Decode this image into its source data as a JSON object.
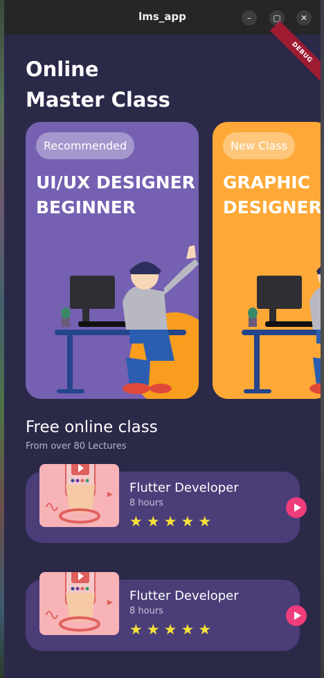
{
  "window": {
    "title": "lms_app",
    "debug_label": "DEBUG"
  },
  "header": {
    "line1": "Online",
    "line2": "Master Class"
  },
  "cards": [
    {
      "badge": "Recommended",
      "title_line1": "UI/UX DESIGNER",
      "title_line2": "BEGINNER",
      "color": "#7560b2"
    },
    {
      "badge": "New Class",
      "title_line1": "GRAPHIC",
      "title_line2": "DESIGNER M",
      "color": "#fea937"
    }
  ],
  "section": {
    "title": "Free online class",
    "subtitle": "From over 80 Lectures"
  },
  "courses": [
    {
      "title": "Flutter Developer",
      "hours": "8 hours",
      "rating": 5
    },
    {
      "title": "Flutter Developer",
      "hours": "8 hours",
      "rating": 5
    }
  ],
  "colors": {
    "background": "#2b2948",
    "accent": "#ef3c7a",
    "star": "#f6e13a",
    "course_bg": "#4a3d78"
  }
}
